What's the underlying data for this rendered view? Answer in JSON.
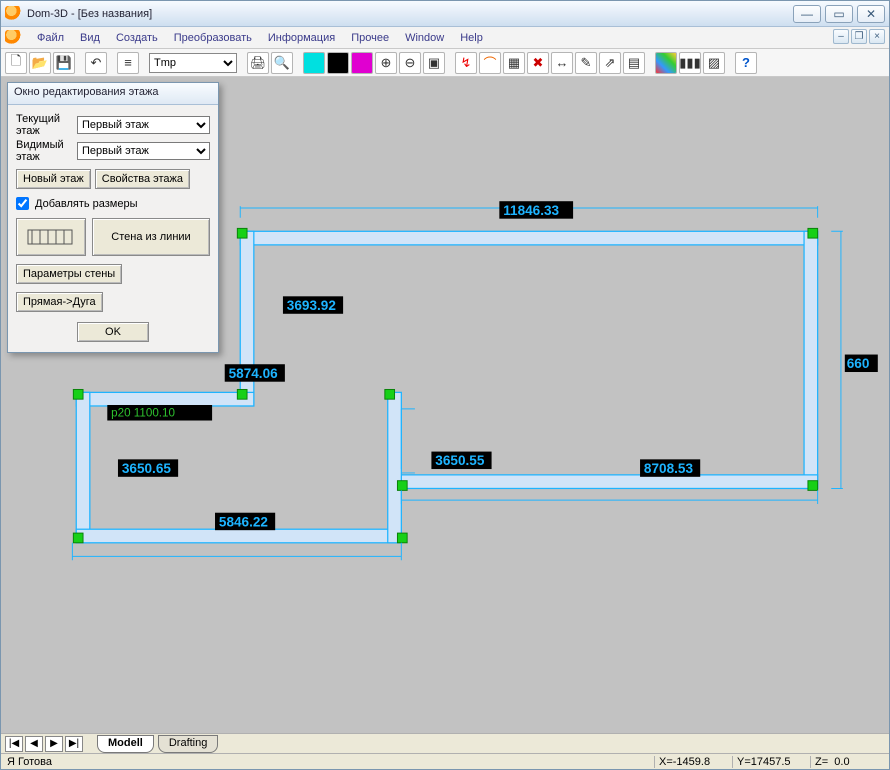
{
  "window": {
    "title": "Dom-3D - [Без названия]"
  },
  "menu": [
    "Файл",
    "Вид",
    "Создать",
    "Преобразовать",
    "Информация",
    "Прочее",
    "Window",
    "Help"
  ],
  "toolbar": {
    "layer_select": "Tmp",
    "help_symbol": "?"
  },
  "tabs": {
    "nav": [
      "|◀",
      "◀",
      "▶",
      "▶|"
    ],
    "items": [
      "Modell",
      "Drafting"
    ],
    "active": 0
  },
  "status": {
    "message": "Я Готова",
    "x_label": "X=",
    "y_label": "Y=",
    "z_label": "Z=",
    "x": "-1459.8",
    "y": "17457.5",
    "z": "0.0"
  },
  "dlg": {
    "title": "Окно редактирования этажа",
    "current_label": "Текущий этаж",
    "visible_label": "Видимый этаж",
    "current_value": "Первый этаж",
    "visible_value": "Первый этаж",
    "new_floor": "Новый этаж",
    "floor_props": "Свойства этажа",
    "add_dims": "Добавлять размеры",
    "wall_from_line": "Стена из линии",
    "wall_params": "Параметры стены",
    "arc_line": "Прямая->Дуга",
    "ok": "OK"
  },
  "dims": {
    "top_outer": "11846.33",
    "right_outer": "660",
    "left_upper": "3693.92",
    "mid_upper": "5874.06",
    "left_lower": "3650.65",
    "mid_lower": "3650.55",
    "bottom_right": "8708.53",
    "bottom_left": "5846.22",
    "hidden_behind_dlg": "p20   1100.10"
  }
}
